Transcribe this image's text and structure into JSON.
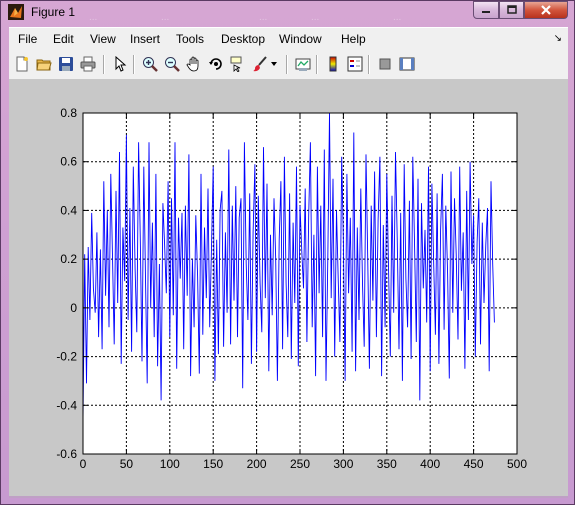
{
  "window": {
    "title": "Figure 1",
    "background_titles": [
      "...",
      "...",
      "...",
      "...",
      "..."
    ]
  },
  "menu": {
    "items": [
      "File",
      "Edit",
      "View",
      "Insert",
      "Tools",
      "Desktop",
      "Window",
      "Help"
    ],
    "dock_arrow": "↘"
  },
  "toolbar": {
    "icons": [
      "new-figure-icon",
      "open-file-icon",
      "save-icon",
      "print-icon",
      "edit-plot-arrow-icon",
      "zoom-in-icon",
      "zoom-out-icon",
      "pan-hand-icon",
      "rotate-3d-icon",
      "data-cursor-icon",
      "brush-icon",
      "brush-dropdown-icon",
      "link-plot-icon",
      "colorbar-icon",
      "legend-icon",
      "hide-plot-tools-icon",
      "show-plot-tools-icon"
    ]
  },
  "colors": {
    "line": "#0000ff",
    "axes_bg": "#ffffff",
    "figure_bg": "#c8c8c8",
    "grid": "#000000"
  },
  "chart_data": {
    "type": "line",
    "title": "",
    "xlabel": "",
    "ylabel": "",
    "xlim": [
      0,
      500
    ],
    "ylim": [
      -0.6,
      0.8
    ],
    "xticks": [
      0,
      50,
      100,
      150,
      200,
      250,
      300,
      350,
      400,
      450,
      500
    ],
    "yticks": [
      -0.6,
      -0.4,
      -0.2,
      0,
      0.2,
      0.4,
      0.6,
      0.8
    ],
    "xtick_labels": [
      "0",
      "50",
      "100",
      "150",
      "200",
      "250",
      "300",
      "350",
      "400",
      "450",
      "500"
    ],
    "ytick_labels": [
      "-0.6",
      "-0.4",
      "-0.2",
      "0",
      "0.2",
      "0.4",
      "0.6",
      "0.8"
    ],
    "grid": true,
    "series": [
      {
        "color": "#0000ff",
        "x_start": 0,
        "x_step": 2,
        "values": [
          -0.47,
          0.22,
          -0.31,
          0.25,
          -0.05,
          0.39,
          0.08,
          -0.02,
          0.31,
          -0.12,
          0.24,
          -0.17,
          0.52,
          0.05,
          0.4,
          -0.08,
          0.55,
          0.21,
          -0.15,
          0.48,
          0.02,
          0.64,
          -0.23,
          0.33,
          0.11,
          0.71,
          -0.05,
          0.41,
          -0.18,
          0.58,
          0.16,
          -0.1,
          0.68,
          0.28,
          -0.22,
          0.58,
          0.12,
          -0.31,
          0.68,
          0.0,
          0.35,
          -0.12,
          0.55,
          -0.24,
          0.18,
          -0.38,
          0.43,
          0.26,
          0.06,
          0.52,
          -0.12,
          0.45,
          -0.03,
          0.68,
          -0.25,
          0.37,
          0.12,
          0.39,
          -0.17,
          0.42,
          0.05,
          0.63,
          -0.28,
          0.2,
          -0.08,
          0.38,
          0.13,
          -0.27,
          0.55,
          -0.11,
          0.33,
          0.04,
          0.49,
          -0.08,
          0.25,
          0.58,
          -0.3,
          0.28,
          -0.19,
          0.4,
          0.48,
          -0.16,
          0.31,
          -0.02,
          0.65,
          -0.15,
          0.42,
          0.03,
          0.5,
          -0.12,
          0.37,
          0.45,
          -0.33,
          0.68,
          0.18,
          -0.05,
          0.47,
          -0.23,
          0.31,
          0.59,
          -0.18,
          0.46,
          0.1,
          -0.1,
          0.66,
          0.04,
          0.51,
          -0.26,
          0.3,
          -0.03,
          0.45,
          0.2,
          -0.3,
          0.28,
          0.52,
          -0.17,
          0.62,
          0.1,
          -0.12,
          0.47,
          -0.21,
          0.35,
          0.02,
          0.58,
          -0.24,
          0.42,
          0.24,
          0.08,
          0.49,
          -0.14,
          0.38,
          0.68,
          -0.08,
          0.3,
          -0.28,
          0.58,
          0.06,
          0.42,
          -0.12,
          0.65,
          -0.3,
          0.2,
          0.8,
          0.04,
          0.53,
          -0.2,
          0.4,
          0.12,
          -0.14,
          0.62,
          0.27,
          -0.3,
          0.55,
          0.06,
          0.37,
          -0.18,
          0.72,
          -0.26,
          0.33,
          -0.05,
          0.49,
          0.1,
          -0.16,
          0.63,
          0.21,
          -0.25,
          0.42,
          0.03,
          0.56,
          -0.12,
          0.36,
          0.62,
          -0.28,
          0.34,
          -0.08,
          0.55,
          0.17,
          -0.2,
          0.46,
          -0.02,
          0.64,
          0.29,
          -0.17,
          0.39,
          -0.3,
          0.59,
          0.12,
          -0.08,
          0.44,
          -0.21,
          0.62,
          0.25,
          -0.14,
          0.53,
          -0.38,
          0.43,
          0.08,
          0.32,
          -0.06,
          0.58,
          -0.26,
          0.51,
          0.18,
          -0.11,
          0.47,
          -0.23,
          0.32,
          0.55,
          -0.09,
          0.42,
          0.14,
          -0.29,
          0.56,
          -0.02,
          0.45,
          0.22,
          -0.13,
          0.58,
          0.07,
          0.31,
          -0.25,
          0.48,
          -0.05,
          0.6,
          0.18,
          0.38,
          -0.2,
          0.27,
          0.45,
          -0.15,
          0.35,
          0.02,
          0.26,
          0.41,
          -0.26,
          0.52,
          0.18,
          -0.06
        ]
      }
    ]
  }
}
